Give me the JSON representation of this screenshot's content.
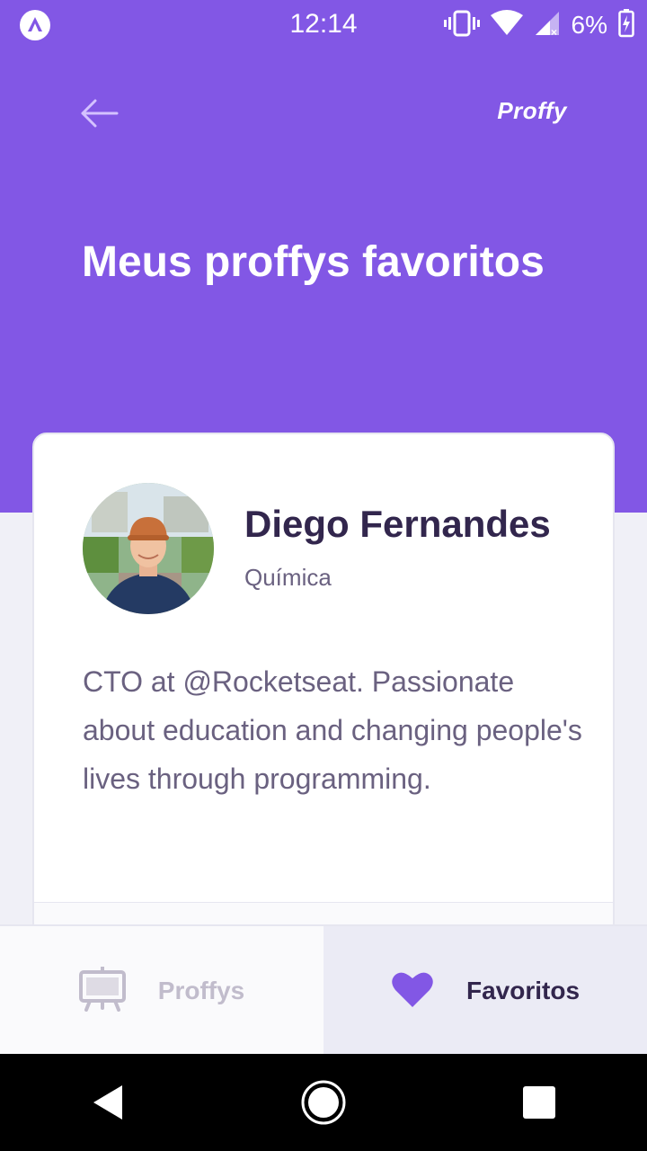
{
  "status_bar": {
    "time": "12:14",
    "battery": "6%",
    "icons": [
      "expo-icon",
      "vibrate-icon",
      "wifi-icon",
      "signal-icon",
      "battery-charging-icon"
    ]
  },
  "header": {
    "back_icon": "arrow-left-icon",
    "brand": "Proffy",
    "title": "Meus proffys favoritos"
  },
  "teacher_card": {
    "name": "Diego Fernandes",
    "subject": "Química",
    "bio": "CTO at @Rocketseat. Passionate about education and changing people's lives through programming."
  },
  "tabs": [
    {
      "label": "Proffys",
      "icon": "easel-icon",
      "active": false
    },
    {
      "label": "Favoritos",
      "icon": "heart-icon",
      "active": true
    }
  ],
  "nav": {
    "icons": [
      "back-triangle-icon",
      "home-circle-icon",
      "recents-square-icon"
    ]
  },
  "colors": {
    "primary": "#8257E5",
    "background": "#F0F0F7",
    "title_dark": "#32264D",
    "text_body": "#6A6180",
    "tab_inactive": "#C1BCCC",
    "tab_active_bg": "#EBEBF5"
  }
}
